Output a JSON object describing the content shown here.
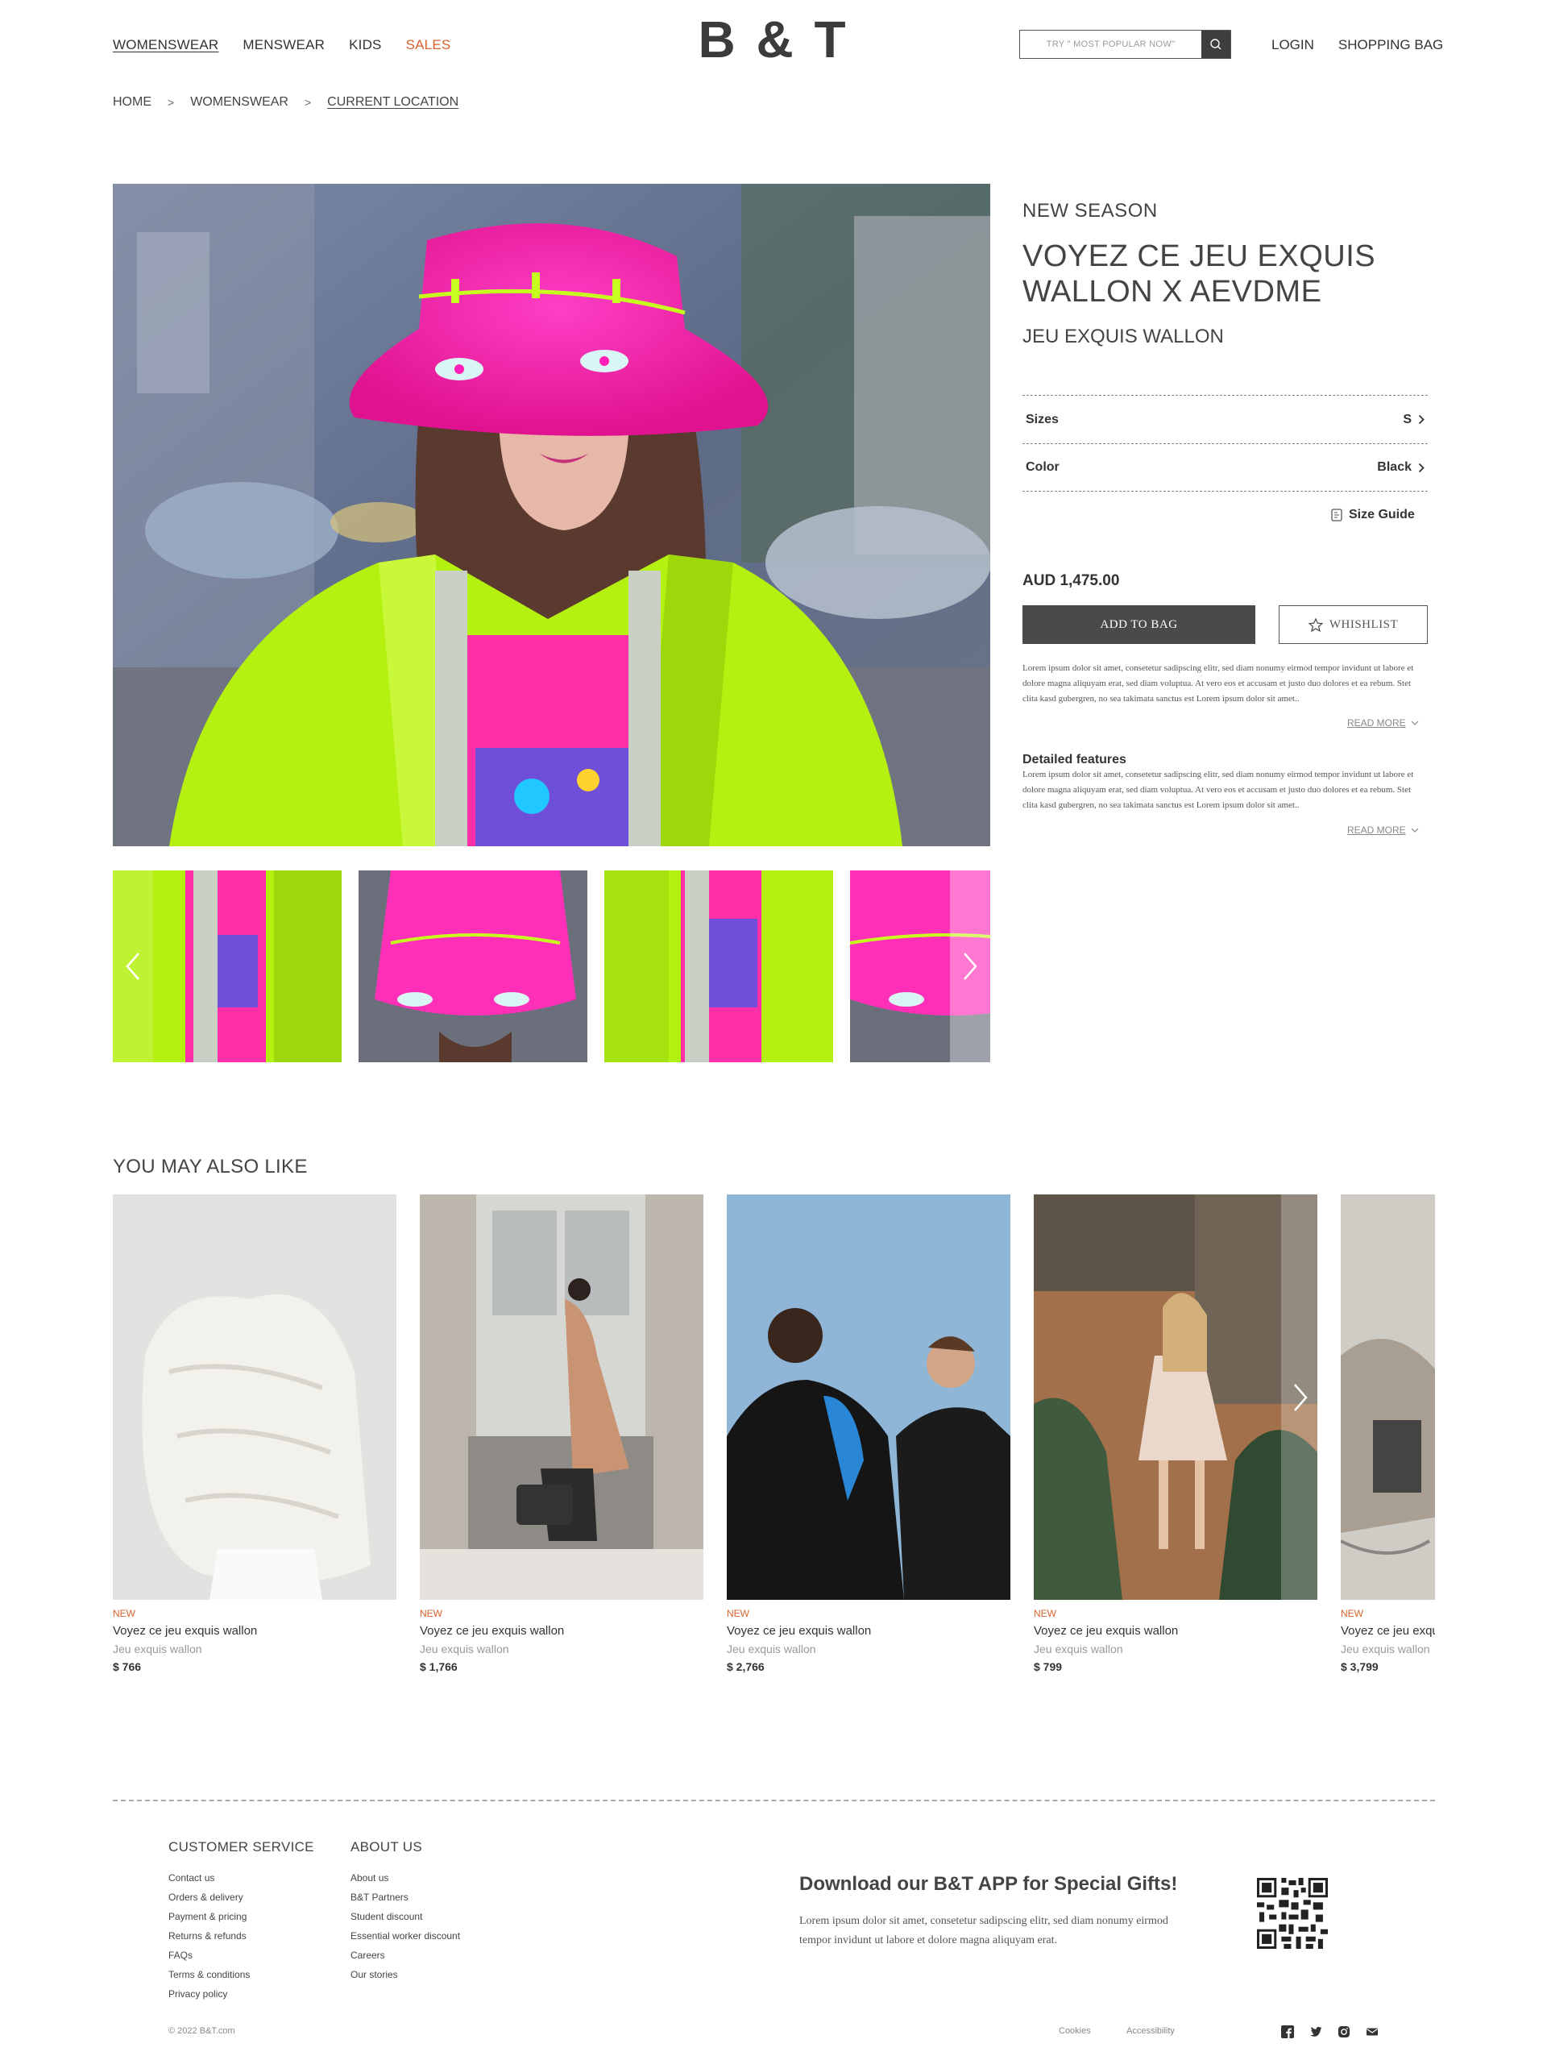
{
  "header": {
    "nav": [
      {
        "label": "WOMENSWEAR"
      },
      {
        "label": "MENSWEAR"
      },
      {
        "label": "KIDS"
      },
      {
        "label": "SALES"
      }
    ],
    "logo": "B & T",
    "search_placeholder": "TRY \" MOST POPULAR NOW\"",
    "login": "LOGIN",
    "bag": "SHOPPING BAG"
  },
  "breadcrumb": {
    "home": "HOME",
    "section": "WOMENSWEAR",
    "current": "CURRENT LOCATION",
    "separator": ">"
  },
  "product": {
    "season": "NEW SEASON",
    "title": "VOYEZ CE JEU EXQUIS WALLON  X  AEVDME",
    "subtitle": "JEU EXQUIS WALLON",
    "size_label": "Sizes",
    "size_value": "S",
    "color_label": "Color",
    "color_value": "Black",
    "size_guide": "Size Guide",
    "price": "AUD 1,475.00",
    "add_to_bag": "ADD TO BAG",
    "wishlist": "WHISHLIST",
    "description": "Lorem ipsum dolor sit amet, consetetur sadipscing elitr, sed diam nonumy eirmod tempor invidunt ut labore et dolore magna aliquyam erat, sed diam voluptua. At vero eos et accusam et justo duo dolores et ea rebum. Stet clita kasd gubergren, no sea takimata sanctus est Lorem ipsum dolor sit amet..",
    "read_more": "READ MORE",
    "features_title": "Detailed features",
    "features_text": "Lorem ipsum dolor sit amet, consetetur sadipscing elitr, sed diam nonumy eirmod tempor invidunt ut labore et dolore magna aliquyam erat, sed diam voluptua. At vero eos et accusam et justo duo dolores et ea rebum. Stet clita kasd gubergren, no sea takimata sanctus est Lorem ipsum dolor sit amet..",
    "read_more_2": "READ MORE"
  },
  "recommendations": {
    "title": "YOU MAY ALSO LIKE",
    "items": [
      {
        "tag": "NEW",
        "name": "Voyez ce jeu exquis wallon",
        "brand": "Jeu exquis wallon",
        "price": "$ 766"
      },
      {
        "tag": "NEW",
        "name": "Voyez ce jeu exquis wallon",
        "brand": "Jeu exquis wallon",
        "price": "$ 1,766"
      },
      {
        "tag": "NEW",
        "name": "Voyez ce jeu exquis wallon",
        "brand": "Jeu exquis wallon",
        "price": "$ 2,766"
      },
      {
        "tag": "NEW",
        "name": "Voyez ce jeu exquis wallon",
        "brand": "Jeu exquis wallon",
        "price": "$ 799"
      },
      {
        "tag": "NEW",
        "name": "Voyez ce jeu exquis wallon",
        "brand": "Jeu exquis wallon",
        "price": "$ 3,799"
      }
    ]
  },
  "footer": {
    "customer_service": {
      "title": "CUSTOMER SERVICE",
      "links": [
        "Contact us",
        "Orders & delivery",
        "Payment & pricing",
        "Returns & refunds",
        "FAQs",
        "Terms & conditions",
        "Privacy policy"
      ]
    },
    "about": {
      "title": "ABOUT US",
      "links": [
        "About us",
        "B&T Partners",
        "Student discount",
        "Essential worker discount",
        "Careers",
        "Our stories"
      ]
    },
    "app_title": "Download our B&T APP for Special Gifts!",
    "app_text": "Lorem ipsum dolor sit amet, consetetur sadipscing elitr, sed diam nonumy eirmod tempor invidunt ut labore et dolore magna aliquyam erat.",
    "copyright": "© 2022 B&T.com",
    "cookies": "Cookies",
    "accessibility": "Accessibility",
    "social_icons": [
      "facebook-icon",
      "twitter-icon",
      "instagram-icon",
      "mail-icon"
    ]
  },
  "colors": {
    "accent": "#d9622b",
    "dark_button": "#4a4a4a",
    "hat_pink": "#ff1fb4",
    "jacket_lime": "#b7f000"
  }
}
